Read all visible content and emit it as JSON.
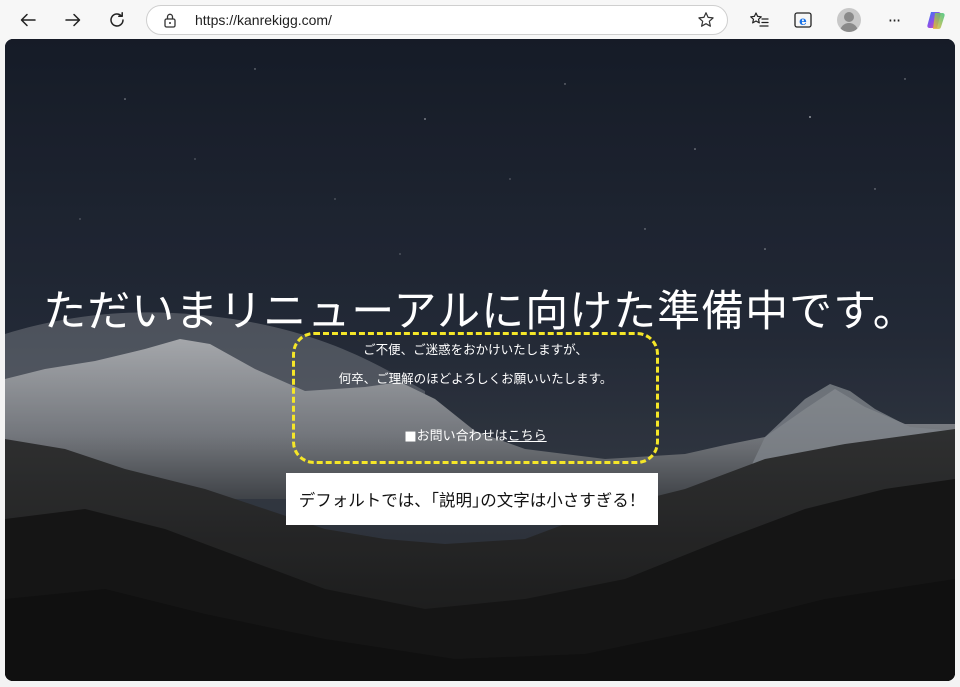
{
  "browser": {
    "url": "https://kanrekigg.com/",
    "icons": [
      "back-arrow-icon",
      "forward-arrow-icon",
      "refresh-icon",
      "lock-icon",
      "favorite-star-icon",
      "favorites-list-icon",
      "ie-mode-icon",
      "profile-avatar-icon",
      "more-menu-icon",
      "copilot-icon"
    ],
    "more_label": "···"
  },
  "page": {
    "headline": "ただいまリニューアルに向けた準備中です。",
    "description_line1": "ご不便、ご迷惑をおかけいたしますが、",
    "description_line2": "何卒、ご理解のほどよろしくお願いいたします。",
    "contact_prefix": "■お問い合わせは",
    "contact_link": "こちら"
  },
  "annotation": {
    "callout_text": "デフォルトでは、｢説明｣の文字は小さすぎる！",
    "highlight_color": "#f5e628"
  }
}
